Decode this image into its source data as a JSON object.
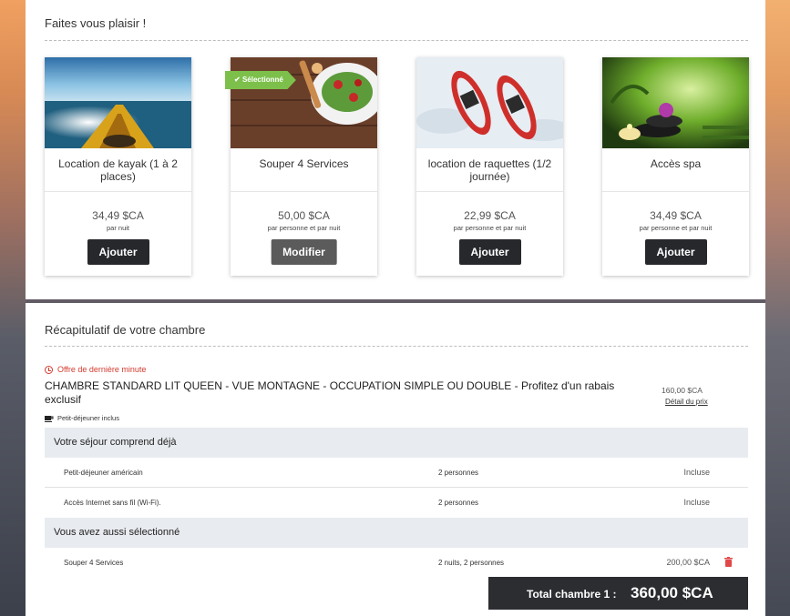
{
  "extras_section": {
    "title": "Faites vous plaisir !",
    "cards": [
      {
        "name": "Location de kayak (1 à 2 places)",
        "price": "34,49 $CA",
        "unit": "par nuit",
        "button": "Ajouter",
        "selected": false
      },
      {
        "name": "Souper 4 Services",
        "price": "50,00 $CA",
        "unit": "par personne et par nuit",
        "button": "Modifier",
        "selected": true,
        "badge": "Sélectionné"
      },
      {
        "name": "location de raquettes (1/2 journée)",
        "price": "22,99 $CA",
        "unit": "par personne et par nuit",
        "button": "Ajouter",
        "selected": false
      },
      {
        "name": "Accès spa",
        "price": "34,49 $CA",
        "unit": "par personne et par nuit",
        "button": "Ajouter",
        "selected": false
      }
    ]
  },
  "summary": {
    "title": "Récapitulatif de votre chambre",
    "offer_label": "Offre de dernière minute",
    "room_title": "CHAMBRE STANDARD LIT QUEEN - VUE MONTAGNE - OCCUPATION SIMPLE OU DOUBLE - Profitez d'un rabais exclusif",
    "room_price": "160,00 $CA",
    "detail_link": "Détail du prix",
    "breakfast_note": "Petit-déjeuner inclus",
    "included_header": "Votre séjour comprend déjà",
    "included_rows": [
      {
        "item": "Petit-déjeuner américain",
        "qty": "2 personnes",
        "price": "Incluse"
      },
      {
        "item": "Accès Internet sans fil (Wi-Fi).",
        "qty": "2 personnes",
        "price": "Incluse"
      }
    ],
    "selected_header": "Vous avez aussi sélectionné",
    "selected_rows": [
      {
        "item": "Souper 4 Services",
        "qty": "2 nuits, 2 personnes",
        "price": "200,00 $CA"
      }
    ],
    "total_label": "Total chambre 1 :",
    "total_value": "360,00 $CA"
  },
  "colors": {
    "accent_green": "#7cc04b",
    "button_dark": "#26282c",
    "offer_red": "#d23b2f",
    "trash_red": "#e04848"
  }
}
